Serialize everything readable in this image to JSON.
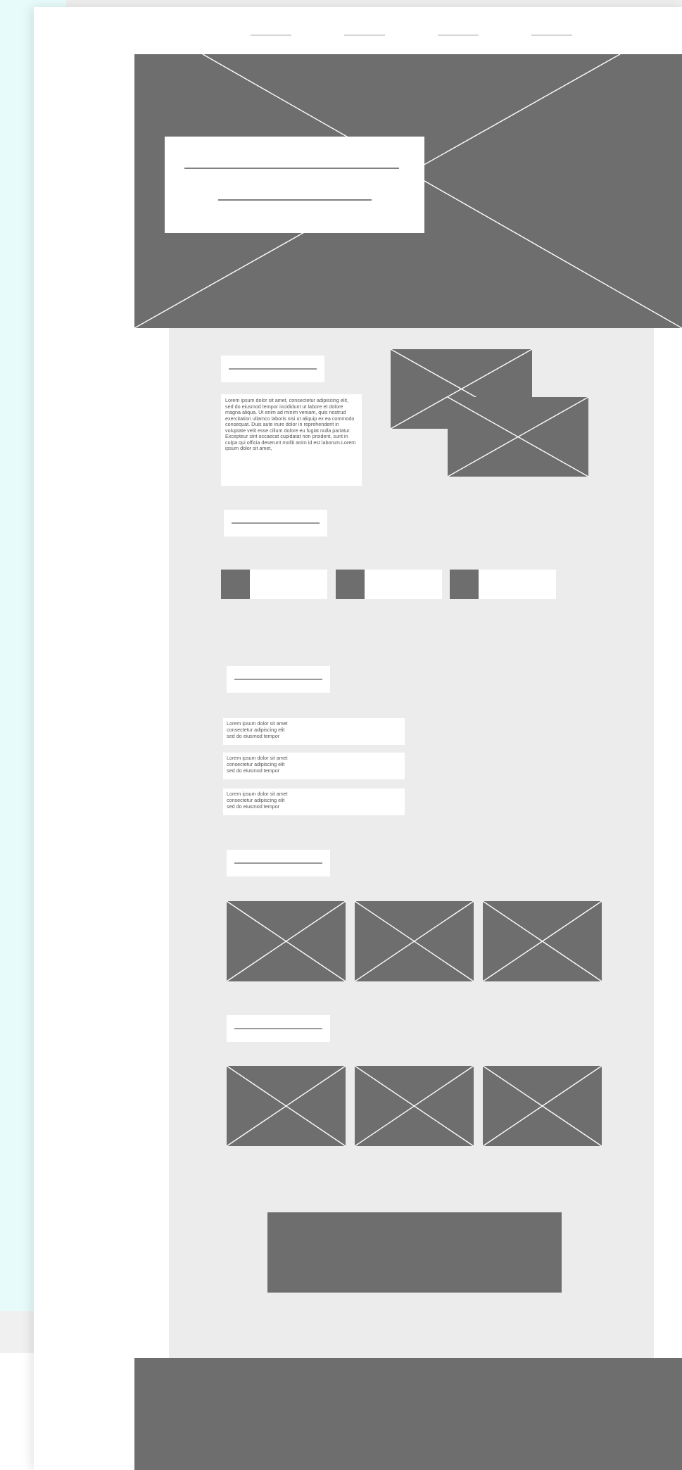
{
  "colors": {
    "placeholder_fill": "#6e6e6e",
    "content_bg": "#ececec",
    "card_bg": "#ffffff",
    "outer_tint": "#e7fbfb",
    "nav_line": "#d6d6d6"
  },
  "intro": {
    "paragraph": "Lorem ipsum dolor sit amet, consectetur adipiscing elit, sed do eiusmod tempor incididunt ut labore et dolore magna aliqua. Ut enim ad minim veniam, quis nostrud exercitation ullamco laboris nisi ut aliquip ex ea commodo consequat. Duis aute irure dolor in reprehenderit in voluptate velit esse cillum dolore eu fugiat nulla pariatur. Excepteur sint occaecat cupidatat non proident, sunt in culpa qui officia deserunt mollit anim id est laborum.Lorem ipsum dolor sit amet,"
  },
  "list": {
    "items": [
      "Lorem ipsum dolor sit amet\nconsectetur adipiscing elit\nsed do eiusmod tempor",
      "Lorem ipsum dolor sit amet\nconsectetur adipiscing elit\nsed do eiusmod tempor",
      "Lorem ipsum dolor sit amet\nconsectetur adipiscing elit\nsed do eiusmod tempor"
    ]
  }
}
